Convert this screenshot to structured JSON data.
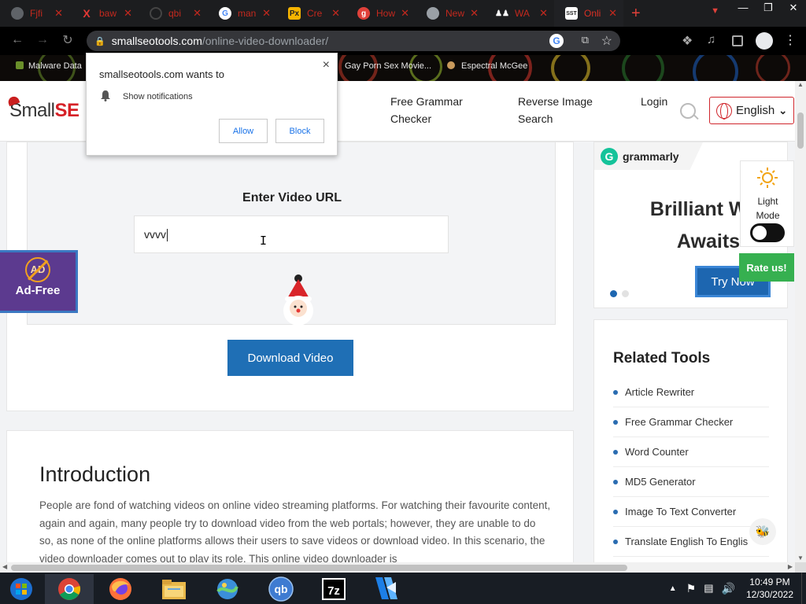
{
  "browser": {
    "tabs": [
      {
        "title": "Fjfi",
        "icon": "globe-icon",
        "color": "#c4291e"
      },
      {
        "title": "baw",
        "icon": "x-brand-icon",
        "color": "#c4291e"
      },
      {
        "title": "qbi",
        "icon": "circle-icon",
        "color": "#c4291e"
      },
      {
        "title": "man",
        "icon": "google-icon",
        "color": "#c4291e"
      },
      {
        "title": "Cre",
        "icon": "pix-icon",
        "color": "#c4291e"
      },
      {
        "title": "How",
        "icon": "g-red-icon",
        "color": "#c4291e"
      },
      {
        "title": "New",
        "icon": "github-icon",
        "color": "#c4291e"
      },
      {
        "title": "WA",
        "icon": "people-icon",
        "color": "#c4291e"
      },
      {
        "title": "Onli",
        "icon": "sst-icon",
        "color": "#d93025",
        "active": true
      }
    ],
    "new_tab_glyph": "+",
    "url_domain": "smallseotools.com",
    "url_path": "/online-video-downloader/",
    "bookmarks": [
      "Malware Data",
      "Gay Porn Sex Movie...",
      "Espectral McGee"
    ]
  },
  "notification_prompt": {
    "title": "smallseotools.com wants to",
    "message": "Show notifications",
    "allow_label": "Allow",
    "block_label": "Block",
    "close_glyph": "×"
  },
  "site": {
    "logo_prefix": "Small",
    "logo_suffix": "SE",
    "nav": [
      "Free Grammar Checker",
      "Reverse Image Search",
      "Login"
    ],
    "nav_line1": [
      "Free Grammar",
      "Reverse Image",
      "Login"
    ],
    "nav_line2": [
      "Checker",
      "Search",
      ""
    ],
    "language": "English",
    "accent_color": "#1f6fb5",
    "brand_red": "#d62127"
  },
  "tool": {
    "heading": "Enter Video URL",
    "input_value": "vvvv",
    "download_label": "Download Video"
  },
  "adfree": {
    "icon_text": "AD",
    "label": "Ad-Free"
  },
  "intro": {
    "title": "Introduction",
    "paragraph": "People are fond of watching videos on online video streaming platforms. For watching their favourite content, again and again, many people try to download video from the web portals; however, they are unable to do so, as none of the online platforms allows their users to save videos or download video. In this scenario, the video downloader comes out to play its role. This online video downloader is"
  },
  "ad": {
    "brand": "grammarly",
    "headline_line1": "Brilliant Writ",
    "headline_line2": "Awaits",
    "cta": "Try Now"
  },
  "light_mode": {
    "label_line1": "Light",
    "label_line2": "Mode",
    "enabled": false
  },
  "rate_label": "Rate us!",
  "related": {
    "title": "Related Tools",
    "items": [
      "Article Rewriter",
      "Free Grammar Checker",
      "Word Counter",
      "MD5 Generator",
      "Image To Text Converter",
      "Translate English To Englis"
    ]
  },
  "taskbar": {
    "apps": [
      "windows-start-icon",
      "chrome-icon",
      "firefox-icon",
      "file-explorer-icon",
      "network-map-icon",
      "qbittorrent-icon",
      "7zip-icon",
      "video-editor-icon"
    ],
    "qb_label": "qb",
    "sevenzip_label": "7z",
    "time": "10:49 PM",
    "date": "12/30/2022"
  }
}
